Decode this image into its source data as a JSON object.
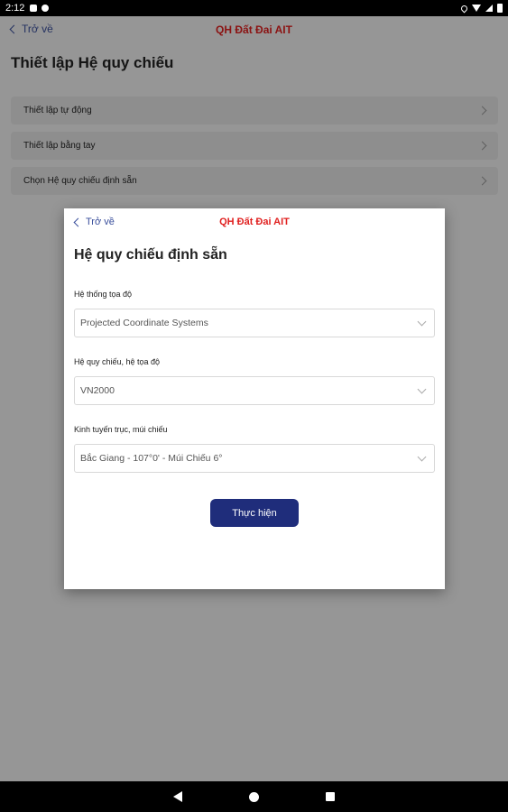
{
  "status_bar": {
    "time": "2:12",
    "icons": [
      "sim-card-icon",
      "no-sync-icon",
      "location-icon",
      "wifi-icon",
      "signal-icon",
      "battery-icon"
    ]
  },
  "background_screen": {
    "back_label": "Trở về",
    "app_title": "QH Đất Đai AIT",
    "page_title": "Thiết lập Hệ quy chiếu",
    "menu_items": [
      {
        "label": "Thiết lập tự động"
      },
      {
        "label": "Thiết lập bằng tay"
      },
      {
        "label": "Chọn Hệ quy chiếu định sẵn"
      }
    ]
  },
  "dialog": {
    "back_label": "Trở về",
    "app_title": "QH Đất Đai AIT",
    "title": "Hệ quy chiếu định sẵn",
    "fields": [
      {
        "label": "Hệ thống tọa độ",
        "value": "Projected Coordinate Systems"
      },
      {
        "label": "Hệ quy chiếu, hệ tọa độ",
        "value": "VN2000"
      },
      {
        "label": "Kinh tuyến trục, múi chiếu",
        "value": "Bắc Giang - 107°0' - Múi Chiếu 6°"
      }
    ],
    "submit_label": "Thực hiện"
  },
  "colors": {
    "accent_red": "#e0201f",
    "primary_blue": "#1f2d7b",
    "link_blue": "#3a4f9c"
  }
}
